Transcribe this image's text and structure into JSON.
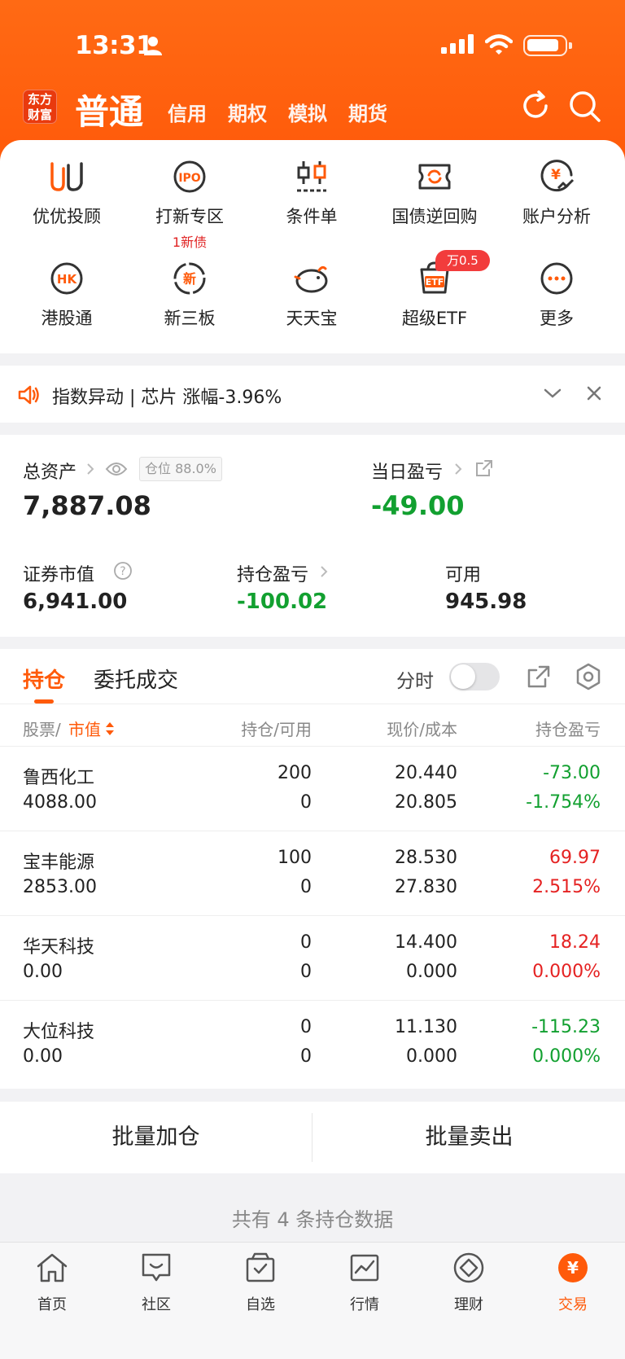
{
  "status_bar": {
    "time": "13:31"
  },
  "header": {
    "logo_text": "东方财富",
    "active_tab": "普通",
    "tabs": [
      "信用",
      "期权",
      "模拟",
      "期货"
    ]
  },
  "quick_grid": [
    {
      "label": "优优投顾",
      "icon": "uu-advisor-icon"
    },
    {
      "label": "打新专区",
      "sub": "1新债",
      "icon": "ipo-icon"
    },
    {
      "label": "条件单",
      "icon": "candlestick-icon"
    },
    {
      "label": "国债逆回购",
      "icon": "repo-icon"
    },
    {
      "label": "账户分析",
      "icon": "yen-chart-icon"
    },
    {
      "label": "港股通",
      "icon": "hk-icon"
    },
    {
      "label": "新三板",
      "icon": "new-board-icon"
    },
    {
      "label": "天天宝",
      "icon": "piggy-bank-icon"
    },
    {
      "label": "超级ETF",
      "badge": "万0.5",
      "icon": "etf-icon"
    },
    {
      "label": "更多",
      "icon": "more-icon"
    }
  ],
  "notice": {
    "text": "指数异动 | 芯片 涨幅-3.96%"
  },
  "assets": {
    "total_label": "总资产",
    "total_value": "7,887.08",
    "position_ratio": "仓位 88.0%",
    "daily_pl_label": "当日盈亏",
    "daily_pl_value": "-49.00",
    "market_value_label": "证券市值",
    "market_value": "6,941.00",
    "holding_pl_label": "持仓盈亏",
    "holding_pl_value": "-100.02",
    "available_label": "可用",
    "available_value": "945.98"
  },
  "positions": {
    "tab_active": "持仓",
    "tab_other": "委托成交",
    "fenshi_label": "分时",
    "headers": {
      "stock": "股票/",
      "market_value": "市值",
      "holding": "持仓/可用",
      "price": "现价/成本",
      "pl": "持仓盈亏"
    },
    "rows": [
      {
        "name": "鲁西化工",
        "market_value": "4088.00",
        "holding": "200",
        "available": "0",
        "price": "20.440",
        "cost": "20.805",
        "pl": "-73.00",
        "pl_pct": "-1.754%",
        "pl_color": "green",
        "pct_color": "green"
      },
      {
        "name": "宝丰能源",
        "market_value": "2853.00",
        "holding": "100",
        "available": "0",
        "price": "28.530",
        "cost": "27.830",
        "pl": "69.97",
        "pl_pct": "2.515%",
        "pl_color": "red",
        "pct_color": "red"
      },
      {
        "name": "华天科技",
        "market_value": "0.00",
        "holding": "0",
        "available": "0",
        "price": "14.400",
        "cost": "0.000",
        "pl": "18.24",
        "pl_pct": "0.000%",
        "pl_color": "red",
        "pct_color": "red"
      },
      {
        "name": "大位科技",
        "market_value": "0.00",
        "holding": "0",
        "available": "0",
        "price": "11.130",
        "cost": "0.000",
        "pl": "-115.23",
        "pl_pct": "0.000%",
        "pl_color": "green",
        "pct_color": "green"
      }
    ]
  },
  "actions": {
    "add": "批量加仓",
    "sell": "批量卖出"
  },
  "summary": "共有 4 条持仓数据",
  "bottom_nav": [
    {
      "label": "首页",
      "icon": "home-icon"
    },
    {
      "label": "社区",
      "icon": "community-icon"
    },
    {
      "label": "自选",
      "icon": "watchlist-icon"
    },
    {
      "label": "行情",
      "icon": "market-icon"
    },
    {
      "label": "理财",
      "icon": "wealth-icon"
    },
    {
      "label": "交易",
      "icon": "trade-icon",
      "active": true
    }
  ],
  "colors": {
    "brand": "#ff5a0a",
    "up": "#e52222",
    "down": "#12a030"
  }
}
